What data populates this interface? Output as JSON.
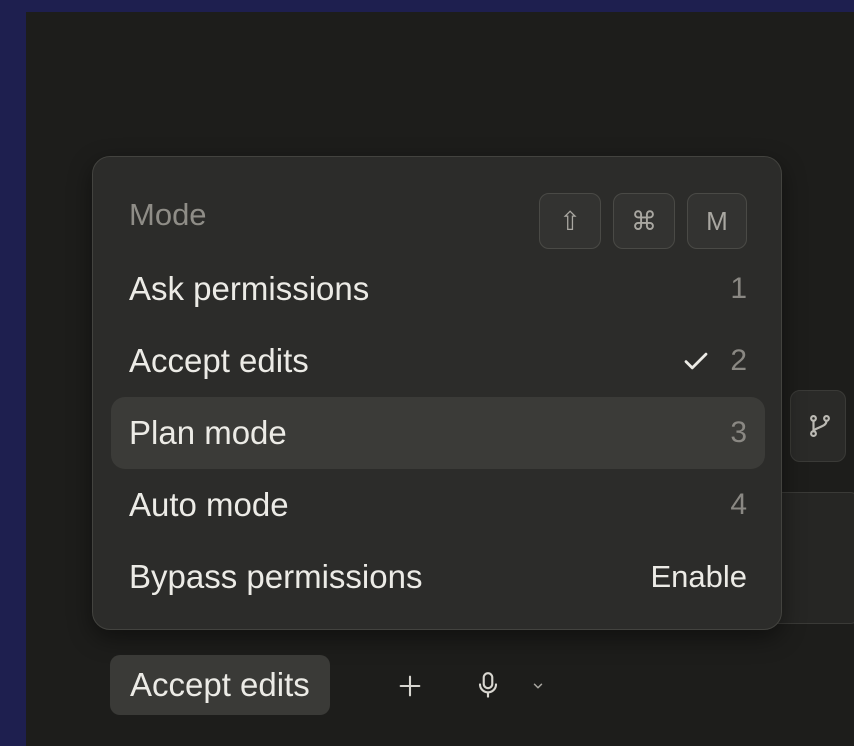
{
  "menu": {
    "title": "Mode",
    "shortcut_keys": [
      {
        "name": "shift-key",
        "symbol": "⇧"
      },
      {
        "name": "command-key",
        "symbol": "⌘"
      },
      {
        "name": "m-key",
        "symbol": "M"
      }
    ],
    "items": [
      {
        "label": "Ask permissions",
        "shortcut": "1",
        "checked": false,
        "highlighted": false
      },
      {
        "label": "Accept edits",
        "shortcut": "2",
        "checked": true,
        "highlighted": false
      },
      {
        "label": "Plan mode",
        "shortcut": "3",
        "checked": false,
        "highlighted": true
      },
      {
        "label": "Auto mode",
        "shortcut": "4",
        "checked": false,
        "highlighted": false
      },
      {
        "label": "Bypass permissions",
        "action": "Enable",
        "checked": false,
        "highlighted": false
      }
    ]
  },
  "toolbar": {
    "mode_label": "Accept edits",
    "icons": [
      "plus-icon",
      "microphone-icon",
      "chevron-down-icon"
    ]
  },
  "side": {
    "branch_icon": "git-branch-icon"
  },
  "colors": {
    "background": "#1e1f4f",
    "window": "#1d1d1b",
    "menu": "#2c2c2a",
    "highlight": "#3b3b38"
  }
}
